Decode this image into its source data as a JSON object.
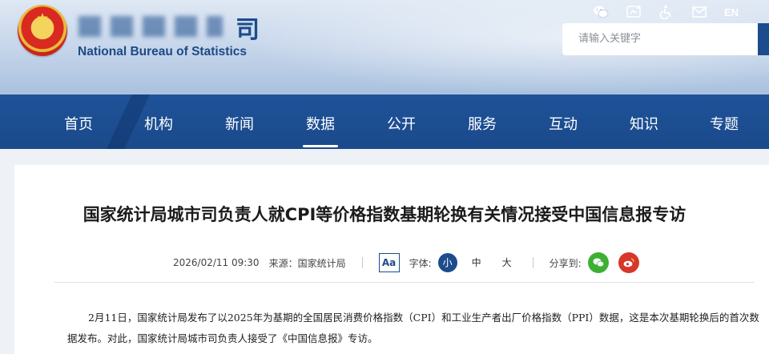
{
  "header": {
    "org_name_cn_visible": "司",
    "org_name_en": "National Bureau of Statistics",
    "language_label": "EN",
    "icons": [
      "wechat-icon",
      "mini-program-icon",
      "accessibility-icon",
      "mail-icon"
    ],
    "search": {
      "placeholder": "请输入关键字"
    }
  },
  "nav": {
    "items": [
      {
        "label": "首页"
      },
      {
        "label": "机构"
      },
      {
        "label": "新闻"
      },
      {
        "label": "数据"
      },
      {
        "label": "公开"
      },
      {
        "label": "服务"
      },
      {
        "label": "互动"
      },
      {
        "label": "知识"
      },
      {
        "label": "专题"
      }
    ],
    "active": "数据"
  },
  "article": {
    "title": "国家统计局城市司负责人就CPI等价格指数基期轮换有关情况接受中国信息报专访",
    "datetime": "2026/02/11 09:30",
    "source": "来源：国家统计局",
    "font_toggle": "Aa",
    "font_label": "字体:",
    "font_sizes": {
      "small": "小",
      "medium": "中",
      "large": "大"
    },
    "selected_font_size": "小",
    "share_label": "分享到:",
    "paragraph": "2月11日，国家统计局发布了以2025年为基期的全国居民消费价格指数（CPI）和工业生产者出厂价格指数（PPI）数据，这是本次基期轮换后的首次数据发布。对此，国家统计局城市司负责人接受了《中国信息报》专访。"
  },
  "colors": {
    "nav_bg": "#1f5299",
    "brand_blue": "#1c4c8c",
    "wechat_green": "#3cb034",
    "weibo_red": "#d8362b"
  }
}
